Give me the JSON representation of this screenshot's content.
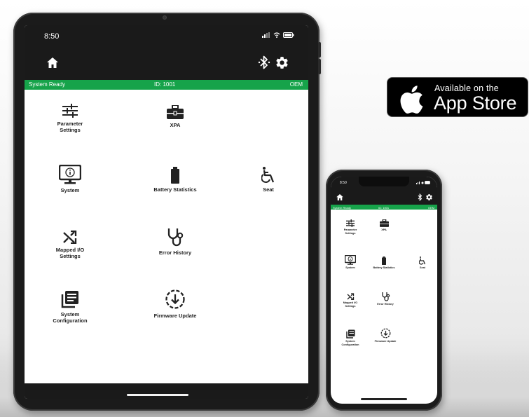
{
  "tablet": {
    "status_time": "8:50",
    "status_label": "System Ready",
    "device_id": "ID: 1001",
    "mode": "OEM",
    "tiles": {
      "parameter_settings": "Parameter\nSettings",
      "xpa": "XPA",
      "system": "System",
      "battery_statistics": "Battery Statistics",
      "seat": "Seat",
      "mapped_io_settings": "Mapped I/O\nSettings",
      "error_history": "Error History",
      "system_configuration": "System\nConfiguration",
      "firmware_update": "Firmware Update"
    }
  },
  "phone": {
    "status_time": "8:50",
    "status_label": "System Ready",
    "device_id": "ID: 1001",
    "mode": "OEM",
    "tiles": {
      "parameter_settings": "Parameter\nSettings",
      "xpa": "XPA",
      "system": "System",
      "battery_statistics": "Battery Statistics",
      "seat": "Seat",
      "mapped_io_settings": "Mapped I/O\nSettings",
      "error_history": "Error History",
      "system_configuration": "System\nConfiguration",
      "firmware_update": "Firmware Update"
    }
  },
  "badge": {
    "line1": "Available on the",
    "line2": "App Store"
  },
  "icons": {
    "home": "home-icon",
    "bluetooth": "bluetooth-icon",
    "settings": "gear-icon"
  },
  "colors": {
    "status_green": "#16a34a",
    "bar_dark": "#1a1a1a"
  }
}
